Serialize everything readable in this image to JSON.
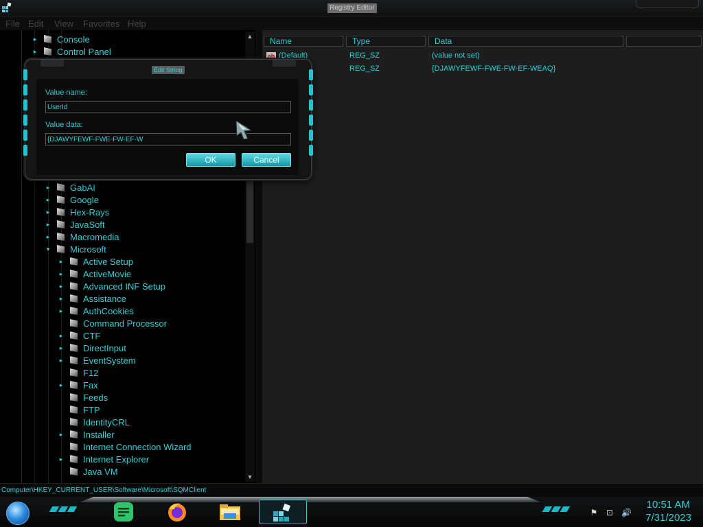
{
  "window": {
    "title": "Registry Editor"
  },
  "menu": [
    "File",
    "Edit",
    "View",
    "Favorites",
    "Help"
  ],
  "tree": {
    "items": [
      {
        "label": "Console",
        "expandable": true,
        "level": 1
      },
      {
        "label": "Control Panel",
        "expandable": true,
        "level": 1
      },
      {
        "label": "GabAI",
        "expandable": true,
        "level": 2
      },
      {
        "label": "Google",
        "expandable": true,
        "level": 2
      },
      {
        "label": "Hex-Rays",
        "expandable": true,
        "level": 2
      },
      {
        "label": "JavaSoft",
        "expandable": true,
        "level": 2
      },
      {
        "label": "Macromedia",
        "expandable": true,
        "level": 2
      },
      {
        "label": "Microsoft",
        "expandable": true,
        "expanded": true,
        "level": 2
      },
      {
        "label": "Active Setup",
        "expandable": true,
        "level": 3
      },
      {
        "label": "ActiveMovie",
        "expandable": true,
        "level": 3
      },
      {
        "label": "Advanced INF Setup",
        "expandable": true,
        "level": 3
      },
      {
        "label": "Assistance",
        "expandable": true,
        "level": 3
      },
      {
        "label": "AuthCookies",
        "expandable": true,
        "level": 3
      },
      {
        "label": "Command Processor",
        "expandable": false,
        "level": 3
      },
      {
        "label": "CTF",
        "expandable": true,
        "level": 3
      },
      {
        "label": "DirectInput",
        "expandable": true,
        "level": 3
      },
      {
        "label": "EventSystem",
        "expandable": true,
        "level": 3
      },
      {
        "label": "F12",
        "expandable": false,
        "level": 3
      },
      {
        "label": "Fax",
        "expandable": true,
        "level": 3
      },
      {
        "label": "Feeds",
        "expandable": false,
        "level": 3
      },
      {
        "label": "FTP",
        "expandable": false,
        "level": 3
      },
      {
        "label": "IdentityCRL",
        "expandable": false,
        "level": 3
      },
      {
        "label": "Installer",
        "expandable": true,
        "level": 3
      },
      {
        "label": "Internet Connection Wizard",
        "expandable": false,
        "level": 3
      },
      {
        "label": "Internet Explorer",
        "expandable": true,
        "level": 3
      },
      {
        "label": "Java VM",
        "expandable": false,
        "level": 3
      }
    ]
  },
  "list": {
    "columns": [
      "Name",
      "Type",
      "Data"
    ],
    "rows": [
      {
        "name": "(Default)",
        "type": "REG_SZ",
        "data": "(value not set)"
      },
      {
        "name": "",
        "type": "REG_SZ",
        "data": "{DJAWYFEWF-FWE-FW-EF-WEAQ}"
      }
    ]
  },
  "status": {
    "path": "Computer\\HKEY_CURRENT_USER\\Software\\Microsoft\\SQMClient"
  },
  "dialog": {
    "title": "Edit String",
    "value_name_label": "Value name:",
    "value_name": "UserId",
    "value_data_label": "Value data:",
    "value_data": "{DJAWYFEWF-FWE-FW-EF-W",
    "ok_label": "OK",
    "cancel_label": "Cancel"
  },
  "taskbar": {
    "apps": [
      "notes-icon",
      "firefox-icon",
      "file-explorer-icon",
      "registry-editor-icon"
    ],
    "tray": [
      "flag-icon",
      "network-icon",
      "volume-icon"
    ],
    "time": "10:51 AM",
    "date": "7/31/2023"
  },
  "colors": {
    "accent": "#2fd0d8",
    "button": "#1ab0bb",
    "background": "#000000"
  }
}
